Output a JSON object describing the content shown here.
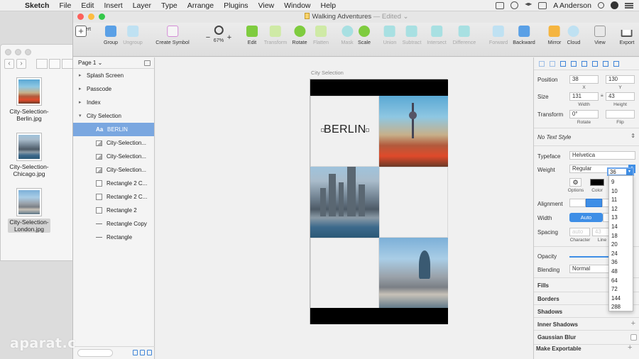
{
  "menubar": {
    "app_name": "Sketch",
    "items": [
      "File",
      "Edit",
      "Insert",
      "Layer",
      "Type",
      "Arrange",
      "Plugins",
      "View",
      "Window",
      "Help"
    ],
    "user": "A Anderson"
  },
  "finder": {
    "files": [
      {
        "name": "City-Selection-Berlin.jpg",
        "line1": "City-Selection-",
        "line2": "Berlin.jpg"
      },
      {
        "name": "City-Selection-Chicago.jpg",
        "line1": "City-Selection-",
        "line2": "Chicago.jpg"
      },
      {
        "name": "City-Selection-London.jpg",
        "line1": "City-Selection-",
        "line2": "London.jpg"
      }
    ]
  },
  "window": {
    "title": "Walking Adventures",
    "status": "— Edited"
  },
  "toolbar": {
    "insert": "Insert",
    "group": "Group",
    "ungroup": "Ungroup",
    "create_symbol": "Create Symbol",
    "zoom_minus": "−",
    "zoom_plus": "+",
    "zoom_level": "67%",
    "edit": "Edit",
    "transform": "Transform",
    "rotate": "Rotate",
    "flatten": "Flatten",
    "mask": "Mask",
    "scale": "Scale",
    "union": "Union",
    "subtract": "Subtract",
    "intersect": "Intersect",
    "difference": "Difference",
    "forward": "Forward",
    "backward": "Backward",
    "mirror": "Mirror",
    "cloud": "Cloud",
    "view": "View",
    "export": "Export"
  },
  "layers": {
    "page": "Page 1",
    "items": [
      {
        "label": "Splash Screen",
        "kind": "group"
      },
      {
        "label": "Passcode",
        "kind": "group"
      },
      {
        "label": "Index",
        "kind": "group"
      },
      {
        "label": "City Selection",
        "kind": "group-open"
      },
      {
        "label": "BERLIN",
        "kind": "text",
        "selected": true
      },
      {
        "label": "City-Selection...",
        "kind": "image"
      },
      {
        "label": "City-Selection...",
        "kind": "image"
      },
      {
        "label": "City-Selection...",
        "kind": "image"
      },
      {
        "label": "Rectangle 2 C...",
        "kind": "rect"
      },
      {
        "label": "Rectangle 2 C...",
        "kind": "rect"
      },
      {
        "label": "Rectangle 2",
        "kind": "rect"
      },
      {
        "label": "Rectangle Copy",
        "kind": "line"
      },
      {
        "label": "Rectangle",
        "kind": "line"
      }
    ]
  },
  "canvas": {
    "artboard_name": "City Selection",
    "berlin_text": "BERLIN"
  },
  "inspector": {
    "position_label": "Position",
    "x_value": "38",
    "y_value": "130",
    "x_label": "X",
    "y_label": "Y",
    "size_label": "Size",
    "width_value": "131",
    "height_value": "43",
    "width_label": "Width",
    "height_label": "Height",
    "transform_label": "Transform",
    "rotate_value": "0°",
    "rotate_label": "Rotate",
    "flip_label": "Flip",
    "text_style": "No Text Style",
    "typeface_label": "Typeface",
    "typeface_value": "Helvetica",
    "weight_label": "Weight",
    "weight_value": "Regular",
    "options_label": "Options",
    "color_label": "Color",
    "font_size": "36",
    "alignment_label": "Alignment",
    "width_mode_label": "Width",
    "width_mode_value": "Auto",
    "spacing_label": "Spacing",
    "character_label": "Character",
    "line_label": "Line",
    "spacing_char_placeholder": "auto",
    "spacing_line_placeholder": "43",
    "opacity_label": "Opacity",
    "blending_label": "Blending",
    "blending_value": "Normal",
    "fills": "Fills",
    "borders": "Borders",
    "shadows": "Shadows",
    "inner_shadows": "Inner Shadows",
    "gaussian_blur": "Gaussian Blur",
    "make_exportable": "Make Exportable"
  },
  "font_size_options": [
    "9",
    "10",
    "11",
    "12",
    "13",
    "14",
    "18",
    "20",
    "24",
    "36",
    "48",
    "64",
    "72",
    "144",
    "288"
  ],
  "watermark": "aparat.c",
  "colors": {
    "selection_blue": "#7aa7e0",
    "accent_blue": "#3e8ee6",
    "traffic_red": "#fc605b",
    "traffic_yellow": "#fdbc40",
    "traffic_green": "#34c84a"
  }
}
